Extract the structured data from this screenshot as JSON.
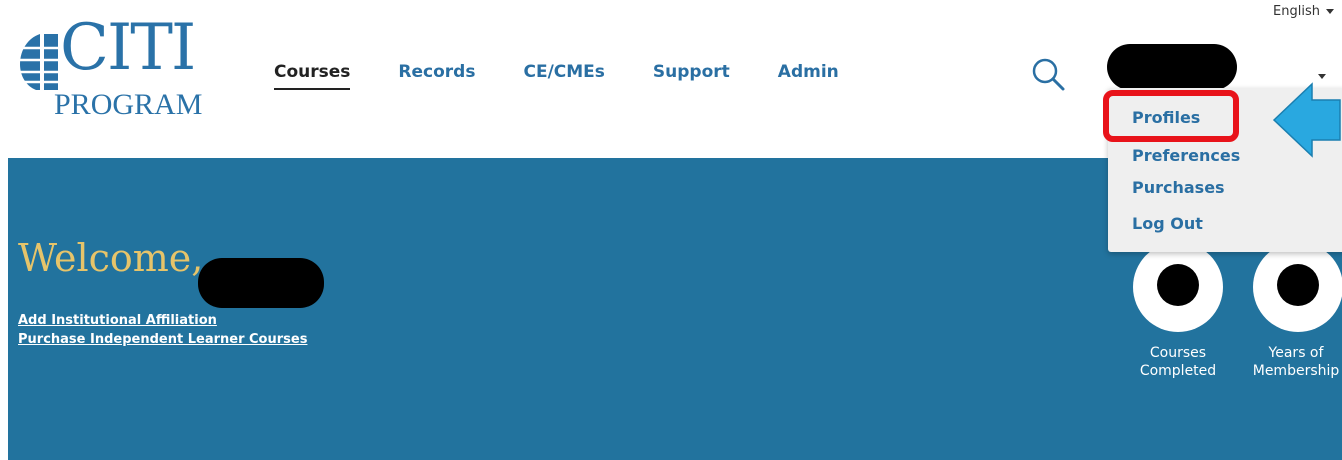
{
  "header": {
    "language": "English",
    "logo": {
      "title": "CITI",
      "subtitle": "PROGRAM"
    },
    "nav": [
      {
        "label": "Courses"
      },
      {
        "label": "Records"
      },
      {
        "label": "CE/CMEs"
      },
      {
        "label": "Support"
      },
      {
        "label": "Admin"
      }
    ],
    "search_icon": "search-icon",
    "user_menu": {
      "items": [
        {
          "label": "Profiles"
        },
        {
          "label": "Preferences"
        },
        {
          "label": "Purchases"
        },
        {
          "label": "Log Out"
        }
      ]
    }
  },
  "banner": {
    "welcome": "Welcome,",
    "links": [
      {
        "label": "Add Institutional Affiliation"
      },
      {
        "label": "Purchase Independent Learner Courses"
      }
    ],
    "stats": [
      {
        "label_line1": "Courses",
        "label_line2": "Completed"
      },
      {
        "label_line1": "Years of",
        "label_line2": "Membership"
      }
    ]
  },
  "colors": {
    "brand_blue": "#2a72a8",
    "banner_blue": "#22739e",
    "welcome_gold": "#e6c46a",
    "annotation_red": "#e8131a",
    "annotation_arrow": "#29a8e0"
  }
}
